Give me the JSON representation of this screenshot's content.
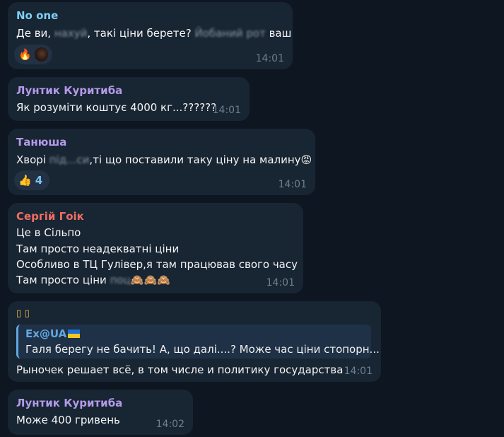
{
  "messages": [
    {
      "author": "No one",
      "author_color": "#7ed0f5",
      "lines": [
        {
          "pre": "Де ви, ",
          "censored": "нахуй",
          "mid": ", такі ціни берете? ",
          "censored2": "Йобаний рот",
          "post": " ваш"
        }
      ],
      "reactions": [
        {
          "icon": "fire-icon",
          "glyph": "🔥"
        },
        {
          "icon": "avatar",
          "glyph": ""
        }
      ],
      "time": "14:01"
    },
    {
      "author": "Лунтик Куритиба",
      "author_color": "#b39ae8",
      "lines": [
        {
          "text": "Як розуміти коштує 4000 кг...??????"
        }
      ],
      "time": "14:01"
    },
    {
      "author": "Танюша",
      "author_color": "#b39ae8",
      "lines": [
        {
          "pre": "Хворі ",
          "censored": "під...си",
          "post": ",ті що поставили таку ціну на малину",
          "emoji": "😡"
        }
      ],
      "reaction": {
        "icon": "thumbs-up-icon",
        "glyph": "👍",
        "count": "4"
      },
      "time": "14:01"
    },
    {
      "author": "Сергій Гоік",
      "author_color": "#ef6e64",
      "lines": [
        {
          "text": "Це в Сільпо"
        },
        {
          "text": "Там просто неадекватні ціни"
        },
        {
          "text": "Особливо в ТЦ Гулівер,я там працював свого часу"
        },
        {
          "pre": "Там просто ціни ",
          "censored": "поц",
          "emoji": "🙈🙈🙈"
        }
      ],
      "time": "14:01"
    },
    {
      "author": "▯ ▯",
      "author_color": "#f0b94a",
      "quote": {
        "author": "Ex@UA",
        "flag": "ukraine-flag",
        "text": "Галя берегу не бачить! А, що далі....? Може час ціни стопорн..."
      },
      "lines": [
        {
          "text": "Рыночек решает всё, в том числе и политику государства"
        }
      ],
      "time": "14:01"
    },
    {
      "author": "Лунтик Куритиба",
      "author_color": "#b39ae8",
      "lines": [
        {
          "text": "Може 400 гривень"
        }
      ],
      "time": "14:02"
    }
  ]
}
